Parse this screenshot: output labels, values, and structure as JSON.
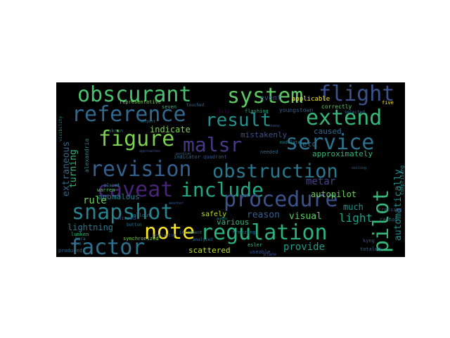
{
  "wordcloud": {
    "words": [
      {
        "text": "obscurant",
        "color": "#48c16e"
      },
      {
        "text": "system",
        "color": "#5ec962"
      },
      {
        "text": "flight",
        "color": "#3b528b"
      },
      {
        "text": "reference",
        "color": "#31688e"
      },
      {
        "text": "result",
        "color": "#21918c"
      },
      {
        "text": "extend",
        "color": "#35b779"
      },
      {
        "text": "figure",
        "color": "#7ad151"
      },
      {
        "text": "malsr",
        "color": "#443983"
      },
      {
        "text": "service",
        "color": "#2c728e"
      },
      {
        "text": "revision",
        "color": "#355f8d"
      },
      {
        "text": "obstruction",
        "color": "#2a788e"
      },
      {
        "text": "caveat",
        "color": "#482475"
      },
      {
        "text": "include",
        "color": "#22a884"
      },
      {
        "text": "pilot",
        "color": "#35b779"
      },
      {
        "text": "procedure",
        "color": "#3b528b"
      },
      {
        "text": "snapshot",
        "color": "#26828e"
      },
      {
        "text": "note",
        "color": "#fde725"
      },
      {
        "text": "regulation",
        "color": "#2db27d"
      },
      {
        "text": "factor",
        "color": "#2c728e"
      },
      {
        "text": "indicate",
        "color": "#7ad151"
      },
      {
        "text": "mistakenly",
        "color": "#3b528b"
      },
      {
        "text": "caused",
        "color": "#31688e"
      },
      {
        "text": "approximately",
        "color": "#35b779"
      },
      {
        "text": "metar",
        "color": "#414487"
      },
      {
        "text": "autopilot",
        "color": "#6ece58"
      },
      {
        "text": "automatically",
        "color": "#21918c"
      },
      {
        "text": "extraneous",
        "color": "#31688e"
      },
      {
        "text": "turning",
        "color": "#35b779"
      },
      {
        "text": "rule",
        "color": "#6ece58"
      },
      {
        "text": "anomalous",
        "color": "#26828e"
      },
      {
        "text": "lightning",
        "color": "#2a788e"
      },
      {
        "text": "reason",
        "color": "#355f8d"
      },
      {
        "text": "visual",
        "color": "#5ec962"
      },
      {
        "text": "light",
        "color": "#1fa088"
      },
      {
        "text": "safely",
        "color": "#b5de2b"
      },
      {
        "text": "various",
        "color": "#35b779"
      },
      {
        "text": "etc",
        "color": "#2c728e"
      },
      {
        "text": "provide",
        "color": "#1fa088"
      },
      {
        "text": "scattered",
        "color": "#b5de2b"
      },
      {
        "text": "much",
        "color": "#21918c"
      },
      {
        "text": "event",
        "color": "#3b528b"
      },
      {
        "text": "applicable",
        "color": "#fde725"
      },
      {
        "text": "correctly",
        "color": "#5ec962"
      },
      {
        "text": "youngstown",
        "color": "#355f8d"
      },
      {
        "text": "representative",
        "color": "#7ad151"
      },
      {
        "text": "seven",
        "color": "#35b779"
      },
      {
        "text": "july",
        "color": "#440154"
      },
      {
        "text": "flashing",
        "color": "#22a884"
      },
      {
        "text": "five",
        "color": "#fde725"
      },
      {
        "text": "akron",
        "color": "#31688e"
      },
      {
        "text": "alexandria",
        "color": "#26828e"
      },
      {
        "text": "freezing",
        "color": "#31688e"
      },
      {
        "text": "warren",
        "color": "#5ec962"
      },
      {
        "text": "placed",
        "color": "#21918c"
      },
      {
        "text": "missed",
        "color": "#3b528b"
      },
      {
        "text": "callout",
        "color": "#2a788e"
      },
      {
        "text": "synchronized",
        "color": "#7ad151"
      },
      {
        "text": "lunken",
        "color": "#35b779"
      },
      {
        "text": "esler",
        "color": "#35b779"
      },
      {
        "text": "useable",
        "color": "#3b528b"
      },
      {
        "text": "produced",
        "color": "#31688e"
      },
      {
        "text": "totaled",
        "color": "#31688e"
      },
      {
        "text": "crossing",
        "color": "#3b528b"
      },
      {
        "text": "canton",
        "color": "#2a788e"
      },
      {
        "text": "kyng",
        "color": "#3b528b"
      },
      {
        "text": "comprising",
        "color": "#21918c"
      },
      {
        "text": "analyzed",
        "color": "#31688e"
      },
      {
        "text": "needed",
        "color": "#31688e"
      },
      {
        "text": "button",
        "color": "#2a788e"
      },
      {
        "text": "plane",
        "color": "#3b528b"
      },
      {
        "text": "audio",
        "color": "#21918c"
      },
      {
        "text": "portion",
        "color": "#31688e"
      },
      {
        "text": "airport",
        "color": "#26828e"
      },
      {
        "text": "runway",
        "color": "#3b528b"
      },
      {
        "text": "visibility",
        "color": "#26828e"
      },
      {
        "text": "ceiling",
        "color": "#31688e"
      },
      {
        "text": "weather",
        "color": "#3b528b"
      },
      {
        "text": "indicator",
        "color": "#31688e"
      },
      {
        "text": "quadrant",
        "color": "#3b528b"
      },
      {
        "text": "increment",
        "color": "#2a788e"
      },
      {
        "text": "projector",
        "color": "#3b528b"
      },
      {
        "text": "modulate",
        "color": "#26828e"
      },
      {
        "text": "touched",
        "color": "#31688e"
      },
      {
        "text": "approaches",
        "color": "#3b528b"
      },
      {
        "text": "selected",
        "color": "#31688e"
      },
      {
        "text": "kara",
        "color": "#2a788e"
      },
      {
        "text": "muni",
        "color": "#31688e"
      }
    ]
  }
}
